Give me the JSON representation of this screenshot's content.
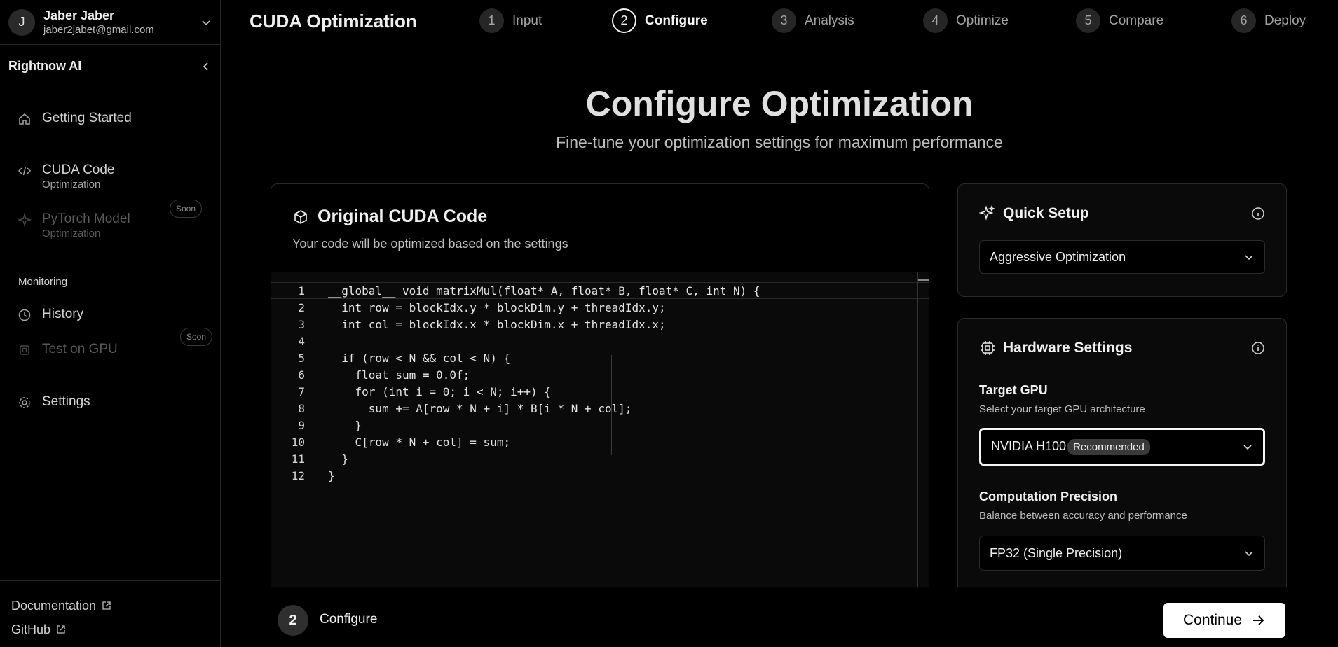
{
  "user": {
    "initial": "J",
    "name": "Jaber Jaber",
    "email": "jaber2jabet@gmail.com"
  },
  "brand": {
    "name": "Rightnow AI"
  },
  "sidebar": {
    "items": [
      {
        "label": "Getting Started",
        "icon": "home-icon"
      },
      {
        "label": "CUDA Code",
        "sub": "Optimization",
        "icon": "code-icon"
      },
      {
        "label": "PyTorch Model",
        "sub": "Optimization",
        "badge": "Soon",
        "icon": "sparkle-icon"
      },
      {
        "label": "History",
        "icon": "history-icon"
      },
      {
        "label": "Test on GPU",
        "badge": "Soon",
        "icon": "chip-icon"
      },
      {
        "label": "Settings",
        "icon": "gear-icon"
      }
    ],
    "section_monitoring": "Monitoring",
    "footer": [
      {
        "label": "Documentation",
        "icon": "external-link-icon"
      },
      {
        "label": "GitHub",
        "icon": "external-link-icon"
      }
    ]
  },
  "header": {
    "title": "CUDA Optimization",
    "steps": [
      {
        "num": "1",
        "label": "Input"
      },
      {
        "num": "2",
        "label": "Configure"
      },
      {
        "num": "3",
        "label": "Analysis"
      },
      {
        "num": "4",
        "label": "Optimize"
      },
      {
        "num": "5",
        "label": "Compare"
      },
      {
        "num": "6",
        "label": "Deploy"
      }
    ],
    "active_step": 2
  },
  "main": {
    "title": "Configure Optimization",
    "subtitle": "Fine-tune your optimization settings for maximum performance",
    "code_card": {
      "title": "Original CUDA Code",
      "subtitle": "Your code will be optimized based on the settings",
      "lines": [
        "__global__ void matrixMul(float* A, float* B, float* C, int N) {",
        "  int row = blockIdx.y * blockDim.y + threadIdx.y;",
        "  int col = blockIdx.x * blockDim.x + threadIdx.x;",
        "",
        "  if (row < N && col < N) {",
        "    float sum = 0.0f;",
        "    for (int i = 0; i < N; i++) {",
        "      sum += A[row * N + i] * B[i * N + col];",
        "    }",
        "    C[row * N + col] = sum;",
        "  }",
        "}"
      ],
      "line_numbers": [
        "1",
        "2",
        "3",
        "4",
        "5",
        "6",
        "7",
        "8",
        "9",
        "10",
        "11",
        "12"
      ]
    },
    "quick_setup": {
      "title": "Quick Setup",
      "selected": "Aggressive Optimization"
    },
    "hardware": {
      "title": "Hardware Settings",
      "gpu_label": "Target GPU",
      "gpu_help": "Select your target GPU architecture",
      "gpu_selected": "NVIDIA H100",
      "gpu_badge": "Recommended",
      "precision_label": "Computation Precision",
      "precision_help": "Balance between accuracy and performance",
      "precision_selected": "FP32 (Single Precision)"
    }
  },
  "footer_bar": {
    "step_num": "2",
    "step_label": "Configure",
    "continue_label": "Continue"
  }
}
